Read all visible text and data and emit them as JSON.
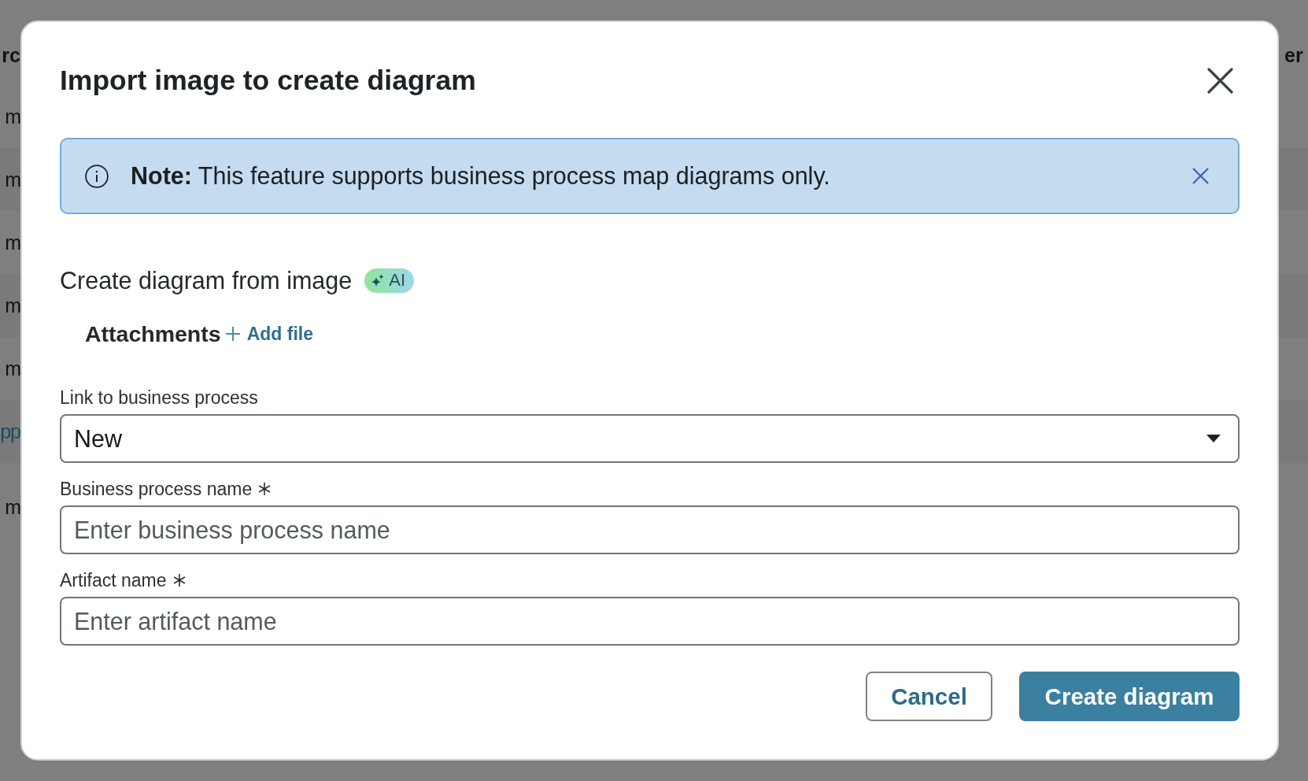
{
  "background": {
    "column_1": {
      "header": "rc",
      "cells": [
        {
          "text": "m",
          "kind": "text"
        },
        {
          "text": "m",
          "kind": "text"
        },
        {
          "text": "m",
          "kind": "text"
        },
        {
          "text": "m",
          "kind": "text"
        },
        {
          "text": "m",
          "kind": "text"
        },
        {
          "text": "pp",
          "kind": "link"
        },
        {
          "text": "m",
          "kind": "text"
        }
      ]
    },
    "column_2": {
      "header": "er"
    }
  },
  "dialog": {
    "title": "Import image to create diagram",
    "note": {
      "text": "**Note:** This feature supports business process map diagrams only.",
      "dismissible": true
    },
    "section": {
      "title": "Create diagram from image",
      "badge": "AI"
    },
    "attachments": {
      "label": "Attachments",
      "action": "Add file"
    },
    "fields": [
      {
        "kind": "select",
        "label": "Link to business process",
        "value": "New",
        "required": false
      },
      {
        "kind": "text",
        "label": "Business process name",
        "placeholder": "Enter business process name",
        "required": true
      },
      {
        "kind": "text",
        "label": "Artifact name",
        "placeholder": "Enter artifact name",
        "required": true
      }
    ],
    "buttons": [
      {
        "label": "Cancel",
        "kind": "secondary"
      },
      {
        "label": "Create diagram",
        "kind": "primary"
      }
    ]
  }
}
